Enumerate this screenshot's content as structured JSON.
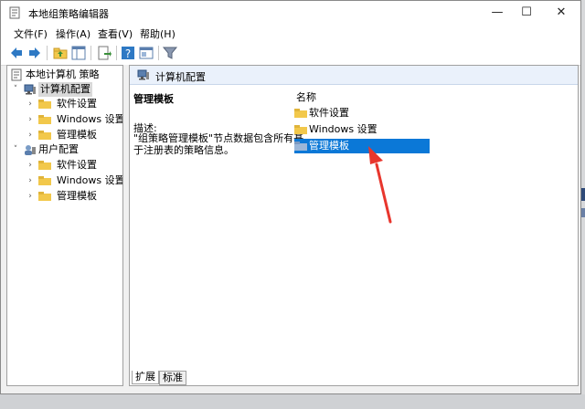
{
  "window": {
    "title": "本地组策略编辑器",
    "controls": {
      "minimize": "—",
      "maximize": "☐",
      "close": "✕"
    }
  },
  "menu": [
    {
      "label": "文件(F)"
    },
    {
      "label": "操作(A)"
    },
    {
      "label": "查看(V)"
    },
    {
      "label": "帮助(H)"
    }
  ],
  "toolbar": {
    "icons": [
      "back-icon",
      "forward-icon",
      "up-folder-icon",
      "show-hide-tree-icon",
      "export-list-icon",
      "help-icon",
      "properties-icon",
      "filter-icon"
    ]
  },
  "tree": {
    "root": "本地计算机 策略",
    "computer_config": "计算机配置",
    "computer_children": [
      "软件设置",
      "Windows 设置",
      "管理模板"
    ],
    "user_config": "用户配置",
    "user_children": [
      "软件设置",
      "Windows 设置",
      "管理模板"
    ]
  },
  "right_pane": {
    "header": "计算机配置",
    "detail_title": "管理模板",
    "detail_label": "描述:",
    "detail_text": "\"组策略管理模板\"节点数据包含所有基于注册表的策略信息。",
    "column_header": "名称",
    "items": [
      {
        "label": "软件设置",
        "selected": false
      },
      {
        "label": "Windows 设置",
        "selected": false
      },
      {
        "label": "管理模板",
        "selected": true
      }
    ]
  },
  "tabs": [
    {
      "label": "扩展",
      "active": true
    },
    {
      "label": "标准",
      "active": false
    }
  ],
  "colors": {
    "selection": "#0b78d7",
    "folder": "#f2c84b",
    "arrow": "#e8362d"
  }
}
